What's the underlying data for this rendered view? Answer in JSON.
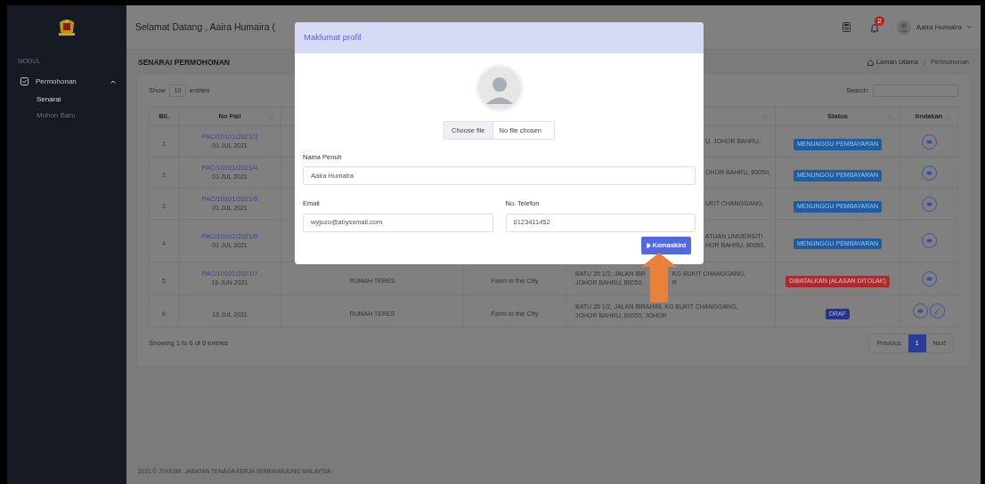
{
  "sidebar": {
    "section_label": "MODUL",
    "items": [
      {
        "label": "Permohonan",
        "expanded": true,
        "children": [
          {
            "label": "Senarai",
            "selected": true
          },
          {
            "label": "Mohon Baru",
            "selected": false
          }
        ]
      }
    ]
  },
  "header": {
    "greeting": "Selamat Datang , Aaira Humaira (",
    "notification_count": "2",
    "user_name": "Aaira Humaira"
  },
  "page": {
    "title": "SENARAI PERMOHONAN",
    "breadcrumb": [
      "Laman Utama",
      "Permohonan"
    ]
  },
  "table": {
    "show_before": "Show",
    "page_size": "10",
    "show_after": "entries",
    "search_label": "Search:",
    "columns": [
      "Bil.",
      "No Fail",
      "Status",
      "tindakan"
    ],
    "rows": [
      {
        "bil": "1",
        "file_no": "PAC/10101/2021/3",
        "date": "01 JUL 2021",
        "address": [
          [
            "U, JOHOR BAHRU,"
          ]
        ],
        "status": {
          "text": "MENUNGGU PEMBAYARAN",
          "kind": "pending"
        },
        "actions": [
          {
            "kind": "view"
          }
        ]
      },
      {
        "bil": "2",
        "file_no": "PAC/10101/2021/4",
        "date": "01 JUL 2021",
        "address": [
          [
            "OHOR BAHRU, 80050,"
          ]
        ],
        "status": {
          "text": "MENUNGGU PEMBAYARAN",
          "kind": "pending"
        },
        "actions": [
          {
            "kind": "view"
          }
        ]
      },
      {
        "bil": "3",
        "file_no": "PAC/10101/2021/5",
        "date": "01 JUL 2021",
        "address": [
          [
            "UKIT CHANGGANG,"
          ]
        ],
        "status": {
          "text": "MENUNGGU PEMBAYARAN",
          "kind": "pending"
        },
        "actions": [
          {
            "kind": "view"
          }
        ]
      },
      {
        "bil": "4",
        "file_no": "PAC/10101/2021/6",
        "date": "01 JUL 2021",
        "address": [
          [
            "ATUAN UNIVERSITI"
          ],
          [
            "HOR BAHRU, 80050,"
          ]
        ],
        "status": {
          "text": "MENUNGGU PEMBAYARAN",
          "kind": "pending"
        },
        "actions": [
          {
            "kind": "view"
          }
        ]
      },
      {
        "bil": "5",
        "file_no": "PAC/10101/2021/7",
        "date": "16 JUN 2021",
        "column_3": "RUMAH TERES",
        "column_4": "Farm in the City",
        "address": [
          [
            "BATU 35 1/2, JALAN IBR",
            "KG BUKIT CHANGGANG,"
          ],
          [
            "JOHOR BAHRU, 80050,",
            "R"
          ]
        ],
        "status": {
          "text": "DIBATALKAN (ALASAN DITOLAK)",
          "kind": "cancelled"
        },
        "actions": [
          {
            "kind": "view"
          }
        ]
      },
      {
        "bil": "6",
        "date": "16 JUL 2021",
        "column_3": "RUMAH TERES",
        "column_4": "Farm in the City",
        "address": [
          [
            "BATU 35 1/2, JALAN IBRAHIM, KG BUKIT CHANGGANG,"
          ],
          [
            "JOHOR BAHRU, 80050, JOHOR"
          ]
        ],
        "status": {
          "text": "DRAF",
          "kind": "draft"
        },
        "actions": [
          {
            "kind": "view"
          },
          {
            "kind": "edit"
          }
        ]
      }
    ],
    "info": "Showing 1 to 6 of 6 entries",
    "pagination": [
      {
        "label": "Previous",
        "selected": false,
        "disabled": true
      },
      {
        "label": "1",
        "selected": true,
        "disabled": false
      },
      {
        "label": "Next",
        "selected": false,
        "disabled": true
      }
    ]
  },
  "modal": {
    "title": "Maklumat profil",
    "file_button": "Choose file",
    "file_status": "No file chosen",
    "fields": [
      {
        "label": "Nama Penuh",
        "value": "Aaira Humaira"
      },
      {
        "label": "Email",
        "value": "wyjozo@abyssmail.com"
      },
      {
        "label": "No. Telefon",
        "value": "0123411452"
      }
    ],
    "submit": "Kemaskini"
  },
  "footer": "2021 © JTKKSM. JABATAN TENAGA KERJA SEMENANJUNG MALAYSIA"
}
